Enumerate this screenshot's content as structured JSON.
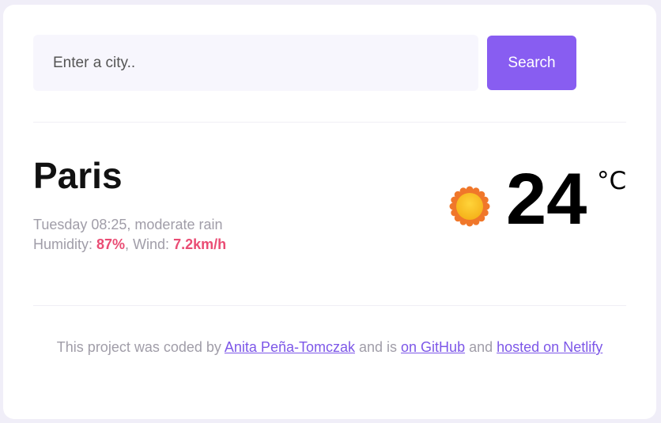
{
  "search": {
    "placeholder": "Enter a city..",
    "button_label": "Search"
  },
  "weather": {
    "city": "Paris",
    "description": "Tuesday 08:25, moderate rain",
    "humidity_label": "Humidity: ",
    "humidity_value": "87%",
    "wind_label": ", Wind: ",
    "wind_value": "7.2km/h",
    "temperature": "24",
    "unit": "°C",
    "icon": "sun-icon"
  },
  "footer": {
    "text_1": "This project was coded by ",
    "author_link": "Anita Peña-Tomczak",
    "text_2": " and is ",
    "github_link": "on GitHub",
    "text_3": " and ",
    "netlify_link": "hosted on Netlify"
  },
  "colors": {
    "accent": "#885df1",
    "highlight": "#ea4c74",
    "muted_text": "#a09da8",
    "link": "#7d57e8"
  }
}
